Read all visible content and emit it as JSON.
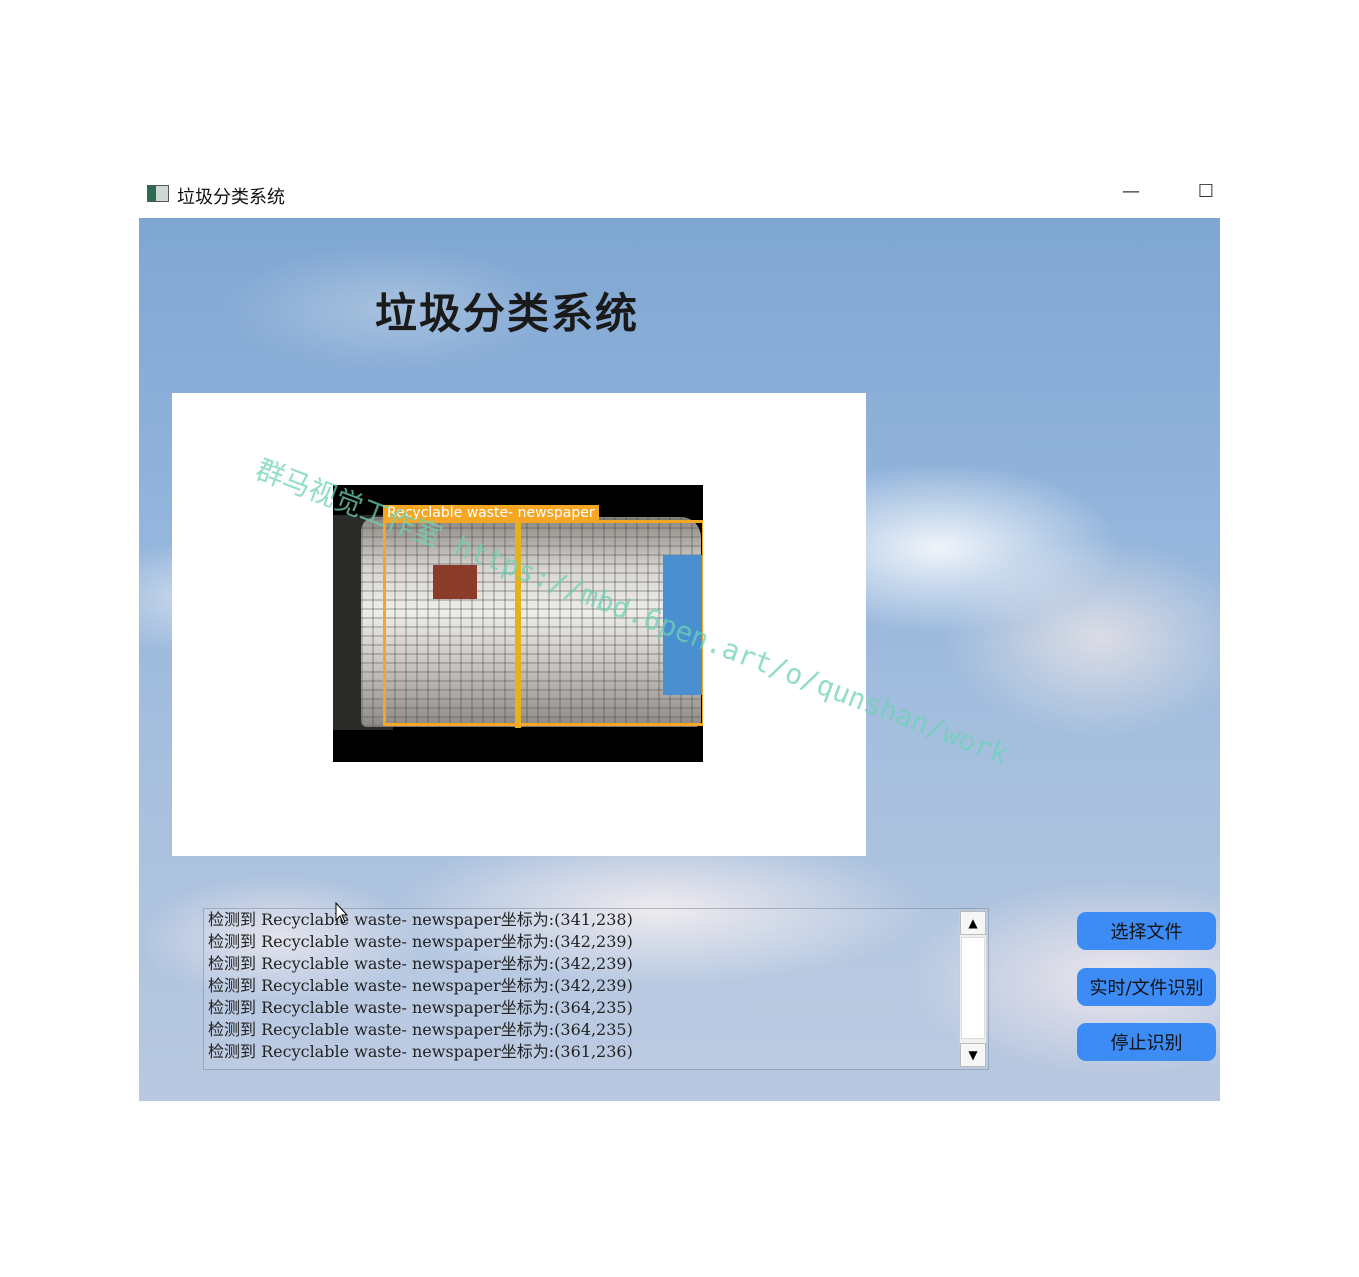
{
  "window": {
    "title": "垃圾分类系统",
    "minimize_glyph": "—",
    "maximize_glyph": "☐"
  },
  "header": {
    "title": "垃圾分类系统"
  },
  "detection": {
    "box_label": "Recyclable waste- newspaper",
    "box_color": "#f5a623"
  },
  "log": {
    "lines": [
      "检测到 Recyclable waste- newspaper坐标为:(341,238)",
      "检测到 Recyclable waste- newspaper坐标为:(342,239)",
      "检测到 Recyclable waste- newspaper坐标为:(342,239)",
      "检测到 Recyclable waste- newspaper坐标为:(342,239)",
      "检测到 Recyclable waste- newspaper坐标为:(364,235)",
      "检测到 Recyclable waste- newspaper坐标为:(364,235)",
      "检测到 Recyclable waste- newspaper坐标为:(361,236)"
    ],
    "scroll_up_glyph": "▲",
    "scroll_down_glyph": "▼"
  },
  "buttons": {
    "select_file": "选择文件",
    "realtime_file_detect": "实时/文件识别",
    "stop_detect": "停止识别",
    "color": "#3d8cf5"
  },
  "watermark": "群马视觉工作室 https://mbd.6pen.art/o/qunshan/work"
}
